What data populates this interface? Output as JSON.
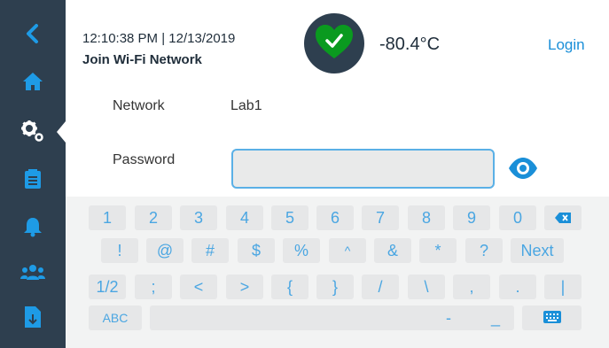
{
  "header": {
    "datetime": "12:10:38 PM | 12/13/2019",
    "page_title": "Join Wi-Fi Network",
    "temperature": "-80.4°C",
    "login_label": "Login",
    "status_icon": "heart-check-icon",
    "status_color": "#0a9a1f"
  },
  "sidebar": {
    "items": [
      {
        "icon": "back-chevron-icon"
      },
      {
        "icon": "home-icon"
      },
      {
        "icon": "settings-gears-icon",
        "active": true
      },
      {
        "icon": "clipboard-icon"
      },
      {
        "icon": "bell-icon"
      },
      {
        "icon": "users-icon"
      },
      {
        "icon": "document-download-icon"
      }
    ]
  },
  "form": {
    "network_label": "Network",
    "network_value": "Lab1",
    "password_label": "Password",
    "password_value": "",
    "password_placeholder": "",
    "show_password_icon": "eye-icon"
  },
  "keyboard": {
    "row1": [
      "1",
      "2",
      "3",
      "4",
      "5",
      "6",
      "7",
      "8",
      "9",
      "0",
      "⌫"
    ],
    "row2": [
      "!",
      "@",
      "#",
      "$",
      "%",
      "^",
      "&",
      "*",
      "?",
      "Next"
    ],
    "row3": [
      "1/2",
      ";",
      "<",
      ">",
      "{",
      "}",
      "/",
      "\\",
      ",",
      ".",
      "|"
    ],
    "row4": [
      "ABC",
      " ",
      "-",
      "_",
      "⌨"
    ]
  },
  "colors": {
    "sidebar": "#2e3f4f",
    "accent": "#1a8fd8",
    "key_text": "#4aa6e2",
    "key_bg": "#e6e7e8"
  }
}
